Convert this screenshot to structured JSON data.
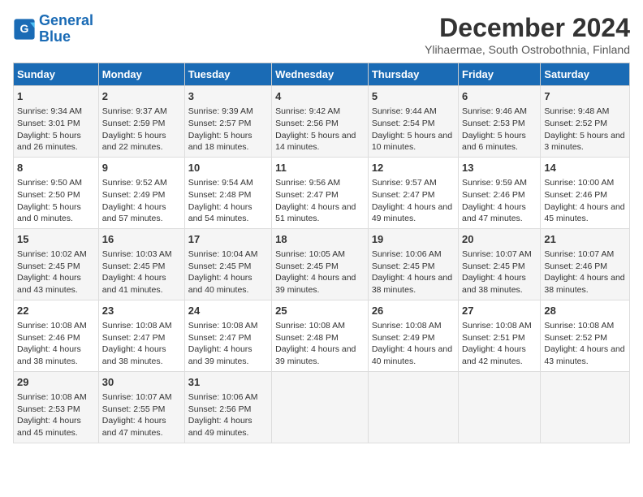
{
  "header": {
    "logo_line1": "General",
    "logo_line2": "Blue",
    "title": "December 2024",
    "subtitle": "Ylihaermae, South Ostrobothnia, Finland"
  },
  "weekdays": [
    "Sunday",
    "Monday",
    "Tuesday",
    "Wednesday",
    "Thursday",
    "Friday",
    "Saturday"
  ],
  "weeks": [
    [
      {
        "day": "1",
        "sunrise": "9:34 AM",
        "sunset": "3:01 PM",
        "daylight": "5 hours and 26 minutes."
      },
      {
        "day": "2",
        "sunrise": "9:37 AM",
        "sunset": "2:59 PM",
        "daylight": "5 hours and 22 minutes."
      },
      {
        "day": "3",
        "sunrise": "9:39 AM",
        "sunset": "2:57 PM",
        "daylight": "5 hours and 18 minutes."
      },
      {
        "day": "4",
        "sunrise": "9:42 AM",
        "sunset": "2:56 PM",
        "daylight": "5 hours and 14 minutes."
      },
      {
        "day": "5",
        "sunrise": "9:44 AM",
        "sunset": "2:54 PM",
        "daylight": "5 hours and 10 minutes."
      },
      {
        "day": "6",
        "sunrise": "9:46 AM",
        "sunset": "2:53 PM",
        "daylight": "5 hours and 6 minutes."
      },
      {
        "day": "7",
        "sunrise": "9:48 AM",
        "sunset": "2:52 PM",
        "daylight": "5 hours and 3 minutes."
      }
    ],
    [
      {
        "day": "8",
        "sunrise": "9:50 AM",
        "sunset": "2:50 PM",
        "daylight": "5 hours and 0 minutes."
      },
      {
        "day": "9",
        "sunrise": "9:52 AM",
        "sunset": "2:49 PM",
        "daylight": "4 hours and 57 minutes."
      },
      {
        "day": "10",
        "sunrise": "9:54 AM",
        "sunset": "2:48 PM",
        "daylight": "4 hours and 54 minutes."
      },
      {
        "day": "11",
        "sunrise": "9:56 AM",
        "sunset": "2:47 PM",
        "daylight": "4 hours and 51 minutes."
      },
      {
        "day": "12",
        "sunrise": "9:57 AM",
        "sunset": "2:47 PM",
        "daylight": "4 hours and 49 minutes."
      },
      {
        "day": "13",
        "sunrise": "9:59 AM",
        "sunset": "2:46 PM",
        "daylight": "4 hours and 47 minutes."
      },
      {
        "day": "14",
        "sunrise": "10:00 AM",
        "sunset": "2:46 PM",
        "daylight": "4 hours and 45 minutes."
      }
    ],
    [
      {
        "day": "15",
        "sunrise": "10:02 AM",
        "sunset": "2:45 PM",
        "daylight": "4 hours and 43 minutes."
      },
      {
        "day": "16",
        "sunrise": "10:03 AM",
        "sunset": "2:45 PM",
        "daylight": "4 hours and 41 minutes."
      },
      {
        "day": "17",
        "sunrise": "10:04 AM",
        "sunset": "2:45 PM",
        "daylight": "4 hours and 40 minutes."
      },
      {
        "day": "18",
        "sunrise": "10:05 AM",
        "sunset": "2:45 PM",
        "daylight": "4 hours and 39 minutes."
      },
      {
        "day": "19",
        "sunrise": "10:06 AM",
        "sunset": "2:45 PM",
        "daylight": "4 hours and 38 minutes."
      },
      {
        "day": "20",
        "sunrise": "10:07 AM",
        "sunset": "2:45 PM",
        "daylight": "4 hours and 38 minutes."
      },
      {
        "day": "21",
        "sunrise": "10:07 AM",
        "sunset": "2:46 PM",
        "daylight": "4 hours and 38 minutes."
      }
    ],
    [
      {
        "day": "22",
        "sunrise": "10:08 AM",
        "sunset": "2:46 PM",
        "daylight": "4 hours and 38 minutes."
      },
      {
        "day": "23",
        "sunrise": "10:08 AM",
        "sunset": "2:47 PM",
        "daylight": "4 hours and 38 minutes."
      },
      {
        "day": "24",
        "sunrise": "10:08 AM",
        "sunset": "2:47 PM",
        "daylight": "4 hours and 39 minutes."
      },
      {
        "day": "25",
        "sunrise": "10:08 AM",
        "sunset": "2:48 PM",
        "daylight": "4 hours and 39 minutes."
      },
      {
        "day": "26",
        "sunrise": "10:08 AM",
        "sunset": "2:49 PM",
        "daylight": "4 hours and 40 minutes."
      },
      {
        "day": "27",
        "sunrise": "10:08 AM",
        "sunset": "2:51 PM",
        "daylight": "4 hours and 42 minutes."
      },
      {
        "day": "28",
        "sunrise": "10:08 AM",
        "sunset": "2:52 PM",
        "daylight": "4 hours and 43 minutes."
      }
    ],
    [
      {
        "day": "29",
        "sunrise": "10:08 AM",
        "sunset": "2:53 PM",
        "daylight": "4 hours and 45 minutes."
      },
      {
        "day": "30",
        "sunrise": "10:07 AM",
        "sunset": "2:55 PM",
        "daylight": "4 hours and 47 minutes."
      },
      {
        "day": "31",
        "sunrise": "10:06 AM",
        "sunset": "2:56 PM",
        "daylight": "4 hours and 49 minutes."
      },
      null,
      null,
      null,
      null
    ]
  ]
}
